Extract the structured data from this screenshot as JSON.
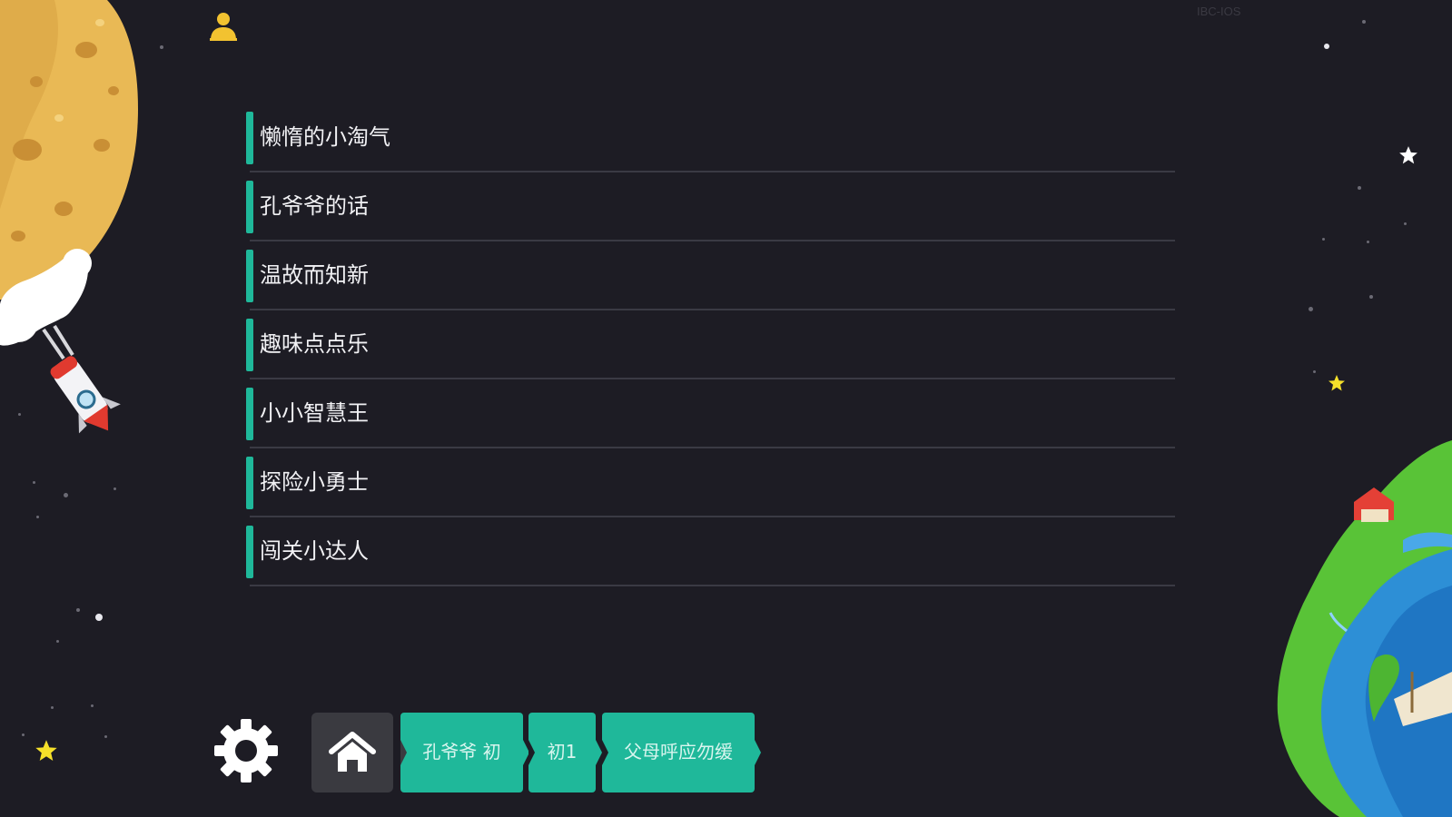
{
  "app": {
    "build_label": "IBC-IOS",
    "accent_color": "#1fb89a",
    "background_color": "#1d1c24"
  },
  "header": {
    "user_icon": "user-icon",
    "user_icon_color": "#f2c230"
  },
  "menu": {
    "items": [
      {
        "label": "懒惰的小淘气"
      },
      {
        "label": "孔爷爷的话"
      },
      {
        "label": "温故而知新"
      },
      {
        "label": "趣味点点乐"
      },
      {
        "label": "小小智慧王"
      },
      {
        "label": "探险小勇士"
      },
      {
        "label": "闯关小达人"
      }
    ]
  },
  "footer": {
    "settings_icon": "gear-icon",
    "home_icon": "home-icon",
    "breadcrumbs": [
      {
        "label": "孔爷爷 初"
      },
      {
        "label": "初1"
      },
      {
        "label": "父母呼应勿缓"
      }
    ]
  },
  "decorations": {
    "planet_left": "cratered-moon",
    "rocket": "rocket",
    "planet_right": "earth-island-globe"
  }
}
